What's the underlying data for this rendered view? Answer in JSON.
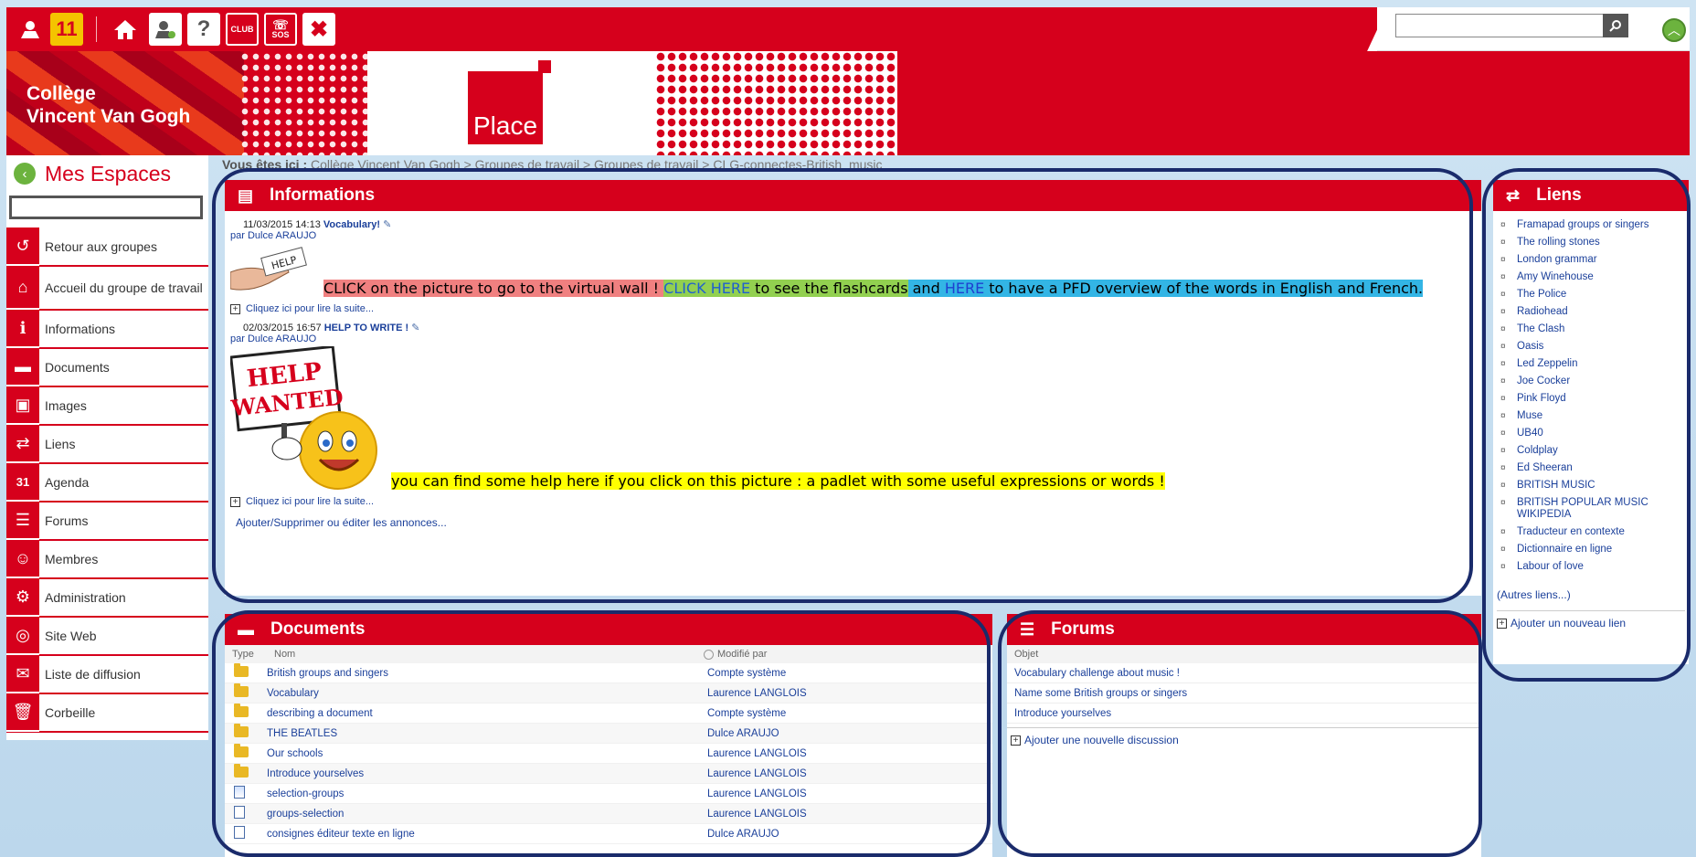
{
  "toolbar": {
    "notif_count": "11",
    "icons": [
      "user-icon",
      "notifications-icon",
      "home-icon",
      "user-settings-icon",
      "help-icon",
      "club-icon",
      "sos-icon",
      "close-icon"
    ],
    "club_label": "CLUB",
    "sos_label": "SOS",
    "search_placeholder": ""
  },
  "banner": {
    "school_line1": "Collège",
    "school_line2": "Vincent Van Gogh",
    "logo_text": "Place"
  },
  "sidebar": {
    "title": "Mes Espaces",
    "items": [
      {
        "label": "Retour aux groupes",
        "icon": "↺"
      },
      {
        "label": "Accueil du groupe de travail",
        "icon": "⌂"
      },
      {
        "label": "Informations",
        "icon": "ℹ"
      },
      {
        "label": "Documents",
        "icon": "▬"
      },
      {
        "label": "Images",
        "icon": "▣"
      },
      {
        "label": "Liens",
        "icon": "⇄"
      },
      {
        "label": "Agenda",
        "icon": "31"
      },
      {
        "label": "Forums",
        "icon": "☰"
      },
      {
        "label": "Membres",
        "icon": "☺"
      },
      {
        "label": "Administration",
        "icon": "⚙"
      },
      {
        "label": "Site Web",
        "icon": "◎"
      },
      {
        "label": "Liste de diffusion",
        "icon": "✉"
      },
      {
        "label": "Corbeille",
        "icon": "🗑"
      }
    ]
  },
  "breadcrumb": {
    "prefix": "Vous êtes ici :",
    "path": "Collège Vincent Van Gogh  > Groupes de travail  > Groupes de travail  > CLG-connectes-British_music"
  },
  "informations": {
    "title": "Informations",
    "posts": [
      {
        "date": "11/03/2015 14:13",
        "title": "Vocabulary!",
        "by": "par Dulce ARAUJO",
        "image_label": "HELP",
        "text_a": "CLICK on the picture to go to the virtual wall ! ",
        "text_b": "CLICK HERE",
        "text_c": " to see the flashcards",
        "text_d": " and ",
        "text_e": "HERE",
        "text_f": " to have a PFD overview of the words in English and French.",
        "readmore": "Cliquez ici pour lire la suite..."
      },
      {
        "date": "02/03/2015 16:57",
        "title": "HELP TO WRITE !",
        "by": "par Dulce ARAUJO",
        "image_line1": "HELP",
        "image_line2": "WANTED",
        "text": "you can find some help here if you click on this picture : a padlet with some useful expressions or words !",
        "readmore": "Cliquez ici pour lire la suite..."
      }
    ],
    "footer_link": "Ajouter/Supprimer ou éditer les annonces..."
  },
  "liens": {
    "title": "Liens",
    "items": [
      "Framapad groups or singers",
      "The rolling stones",
      "London grammar",
      "Amy Winehouse",
      "The Police",
      "Radiohead",
      "The Clash",
      "Oasis",
      "Led Zeppelin",
      "Joe Cocker",
      "Pink Floyd",
      "Muse",
      "UB40",
      "Coldplay",
      "Ed Sheeran",
      "BRITISH MUSIC",
      "BRITISH POPULAR MUSIC WIKIPEDIA",
      "Traducteur en contexte",
      "Dictionnaire en ligne",
      "Labour of love"
    ],
    "more": "(Autres liens...)",
    "add": "Ajouter un nouveau lien"
  },
  "documents": {
    "title": "Documents",
    "col_type": "Type",
    "col_name": "Nom",
    "col_by": "Modifié par",
    "rows": [
      {
        "type": "folder",
        "name": "British groups and singers",
        "by": "Compte système"
      },
      {
        "type": "folder",
        "name": "Vocabulary",
        "by": "Laurence LANGLOIS"
      },
      {
        "type": "folder",
        "name": "describing a document",
        "by": "Compte système"
      },
      {
        "type": "folder",
        "name": "THE BEATLES",
        "by": "Dulce ARAUJO"
      },
      {
        "type": "folder",
        "name": "Our schools",
        "by": "Laurence LANGLOIS"
      },
      {
        "type": "folder",
        "name": "Introduce yourselves",
        "by": "Laurence LANGLOIS"
      },
      {
        "type": "file-color",
        "name": "selection-groups",
        "by": "Laurence LANGLOIS"
      },
      {
        "type": "file",
        "name": "groups-selection",
        "by": "Laurence LANGLOIS"
      },
      {
        "type": "file",
        "name": "consignes éditeur texte en ligne",
        "by": "Dulce ARAUJO"
      }
    ]
  },
  "forums": {
    "title": "Forums",
    "col_subject": "Objet",
    "rows": [
      "Vocabulary challenge about music !",
      "Name some British groups or singers",
      "Introduce yourselves"
    ],
    "add": "Ajouter une nouvelle discussion"
  },
  "colors": {
    "brand_red": "#d6001c",
    "ring": "#1a2b6b",
    "accent_green": "#6cb33e"
  }
}
